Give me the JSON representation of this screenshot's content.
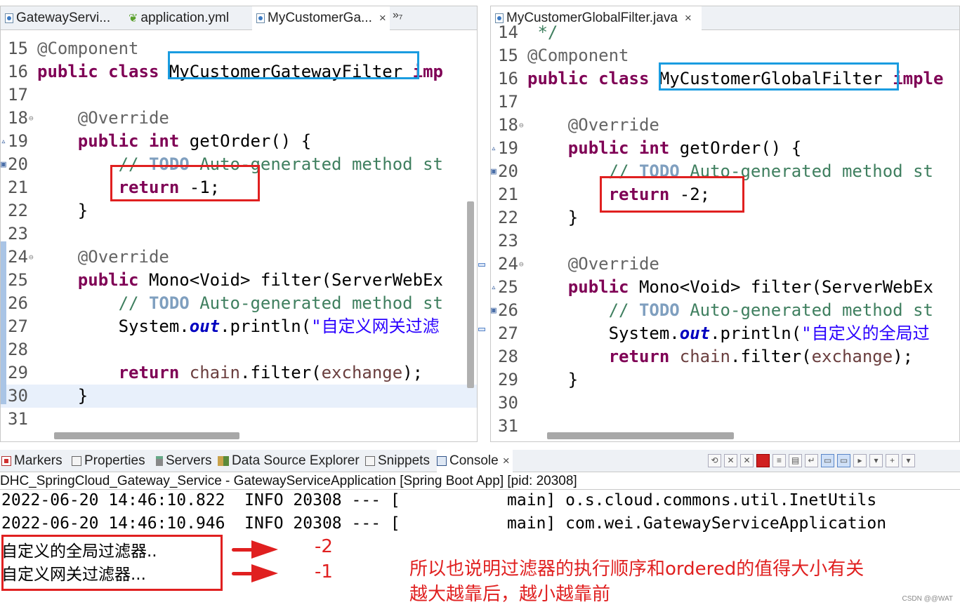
{
  "editor_left": {
    "tabs": [
      {
        "label": "GatewayServi..."
      },
      {
        "label": "application.yml"
      },
      {
        "label": "MyCustomerGa..."
      }
    ],
    "overflow": "»₇",
    "lines": [
      {
        "n": "15",
        "segments": [
          [
            "ann",
            "@Component"
          ]
        ]
      },
      {
        "n": "16",
        "segments": [
          [
            "kw",
            "public"
          ],
          [
            "",
            " "
          ],
          [
            "kw",
            "class"
          ],
          [
            "",
            " MyCustomerGatewayFilter "
          ],
          [
            "kw",
            "imp"
          ]
        ]
      },
      {
        "n": "17",
        "segments": []
      },
      {
        "n": "18",
        "fold": "⊖",
        "segments": [
          [
            "",
            "    "
          ],
          [
            "ann",
            "@Override"
          ]
        ]
      },
      {
        "n": "19",
        "marker": "▵",
        "segments": [
          [
            "",
            "    "
          ],
          [
            "kw",
            "public"
          ],
          [
            "",
            " "
          ],
          [
            "kw",
            "int"
          ],
          [
            "",
            " getOrder() {"
          ]
        ]
      },
      {
        "n": "20",
        "marker": "▣",
        "segments": [
          [
            "",
            "        "
          ],
          [
            "cm",
            "// "
          ],
          [
            "todo",
            "TODO"
          ],
          [
            "cm",
            " Auto-generated method st"
          ]
        ]
      },
      {
        "n": "21",
        "segments": [
          [
            "",
            "        "
          ],
          [
            "kw",
            "return"
          ],
          [
            "",
            " -1;"
          ]
        ]
      },
      {
        "n": "22",
        "segments": [
          [
            "",
            "    }"
          ]
        ]
      },
      {
        "n": "23",
        "segments": []
      },
      {
        "n": "24",
        "fold": "⊖",
        "segments": [
          [
            "",
            "    "
          ],
          [
            "ann",
            "@Override"
          ]
        ]
      },
      {
        "n": "25",
        "marker": "▵",
        "segments": [
          [
            "",
            "    "
          ],
          [
            "kw",
            "public"
          ],
          [
            "",
            " Mono<Void> filter(ServerWebEx"
          ]
        ]
      },
      {
        "n": "26",
        "marker": "▣",
        "segments": [
          [
            "",
            "        "
          ],
          [
            "cm",
            "// "
          ],
          [
            "todo",
            "TODO"
          ],
          [
            "cm",
            " Auto-generated method st"
          ]
        ]
      },
      {
        "n": "27",
        "segments": [
          [
            "",
            "        System."
          ],
          [
            "field",
            "out"
          ],
          [
            "",
            ".println("
          ],
          [
            "str",
            "\"自定义网关过滤"
          ]
        ]
      },
      {
        "n": "28",
        "segments": []
      },
      {
        "n": "29",
        "segments": [
          [
            "",
            "        "
          ],
          [
            "kw",
            "return"
          ],
          [
            "",
            " "
          ],
          [
            "param",
            "chain"
          ],
          [
            "",
            ".filter("
          ],
          [
            "param",
            "exchange"
          ],
          [
            "",
            ");"
          ]
        ]
      },
      {
        "n": "30",
        "current": true,
        "segments": [
          [
            "",
            "    }"
          ]
        ]
      },
      {
        "n": "31",
        "segments": []
      }
    ]
  },
  "editor_right": {
    "tabs": [
      {
        "label": "MyCustomerGlobalFilter.java"
      }
    ],
    "lines": [
      {
        "n": "14",
        "segments": [
          [
            "cm",
            " */"
          ]
        ]
      },
      {
        "n": "15",
        "segments": [
          [
            "ann",
            "@Component"
          ]
        ]
      },
      {
        "n": "16",
        "segments": [
          [
            "kw",
            "public"
          ],
          [
            "",
            " "
          ],
          [
            "kw",
            "class"
          ],
          [
            "",
            " MyCustomerGlobalFilter "
          ],
          [
            "kw",
            "imple"
          ]
        ]
      },
      {
        "n": "17",
        "segments": []
      },
      {
        "n": "18",
        "fold": "⊖",
        "segments": [
          [
            "",
            "    "
          ],
          [
            "ann",
            "@Override"
          ]
        ]
      },
      {
        "n": "19",
        "marker": "▵",
        "segments": [
          [
            "",
            "    "
          ],
          [
            "kw",
            "public"
          ],
          [
            "",
            " "
          ],
          [
            "kw",
            "int"
          ],
          [
            "",
            " getOrder() {"
          ]
        ]
      },
      {
        "n": "20",
        "marker": "▣",
        "segments": [
          [
            "",
            "        "
          ],
          [
            "cm",
            "// "
          ],
          [
            "todo",
            "TODO"
          ],
          [
            "cm",
            " Auto-generated method st"
          ]
        ]
      },
      {
        "n": "21",
        "segments": [
          [
            "",
            "        "
          ],
          [
            "kw",
            "return"
          ],
          [
            "",
            " -2;"
          ]
        ]
      },
      {
        "n": "22",
        "segments": [
          [
            "",
            "    }"
          ]
        ]
      },
      {
        "n": "23",
        "segments": []
      },
      {
        "n": "24",
        "fold": "⊖",
        "segments": [
          [
            "",
            "    "
          ],
          [
            "ann",
            "@Override"
          ]
        ]
      },
      {
        "n": "25",
        "marker": "▵",
        "segments": [
          [
            "",
            "    "
          ],
          [
            "kw",
            "public"
          ],
          [
            "",
            " Mono<Void> filter(ServerWebEx"
          ]
        ]
      },
      {
        "n": "26",
        "marker": "▣",
        "segments": [
          [
            "",
            "        "
          ],
          [
            "cm",
            "// "
          ],
          [
            "todo",
            "TODO"
          ],
          [
            "cm",
            " Auto-generated method st"
          ]
        ]
      },
      {
        "n": "27",
        "segments": [
          [
            "",
            "        System."
          ],
          [
            "field",
            "out"
          ],
          [
            "",
            ".println("
          ],
          [
            "str",
            "\"自定义的全局过"
          ]
        ]
      },
      {
        "n": "28",
        "segments": [
          [
            "",
            "        "
          ],
          [
            "kw",
            "return"
          ],
          [
            "",
            " "
          ],
          [
            "param",
            "chain"
          ],
          [
            "",
            ".filter("
          ],
          [
            "param",
            "exchange"
          ],
          [
            "",
            ");"
          ]
        ]
      },
      {
        "n": "29",
        "segments": [
          [
            "",
            "    }"
          ]
        ]
      },
      {
        "n": "30",
        "segments": []
      },
      {
        "n": "31",
        "segments": []
      }
    ]
  },
  "views": {
    "tabs": [
      {
        "label": "Markers",
        "icon": "markers-icon"
      },
      {
        "label": "Properties",
        "icon": "properties-icon"
      },
      {
        "label": "Servers",
        "icon": "servers-icon"
      },
      {
        "label": "Data Source Explorer",
        "icon": "data-source-icon"
      },
      {
        "label": "Snippets",
        "icon": "snippets-icon"
      },
      {
        "label": "Console",
        "icon": "console-icon"
      }
    ],
    "console_title": "DHC_SpringCloud_Gateway_Service - GatewayServiceApplication [Spring Boot App]  [pid: 20308]",
    "console_lines": [
      "2022-06-20 14:46:10.822  INFO 20308 --- [           main] o.s.cloud.commons.util.InetUtils",
      "2022-06-20 14:46:10.946  INFO 20308 --- [           main] com.wei.GatewayServiceApplication",
      "自定义的全局过滤器..",
      "自定义网关过滤器..."
    ]
  },
  "annotations": {
    "label_global": "-2",
    "label_gateway": "-1",
    "note_line1": "所以也说明过滤器的执行顺序和ordered的值得大小有关",
    "note_line2": "越大越靠后，越小越靠前",
    "watermark": "CSDN @@WAT"
  },
  "colors": {
    "keyword": "#7f0055",
    "annotation": "#646464",
    "comment": "#3f7f5f",
    "string": "#2a00ff",
    "highlight_red": "#e02020",
    "highlight_blue": "#1a9ce0"
  }
}
